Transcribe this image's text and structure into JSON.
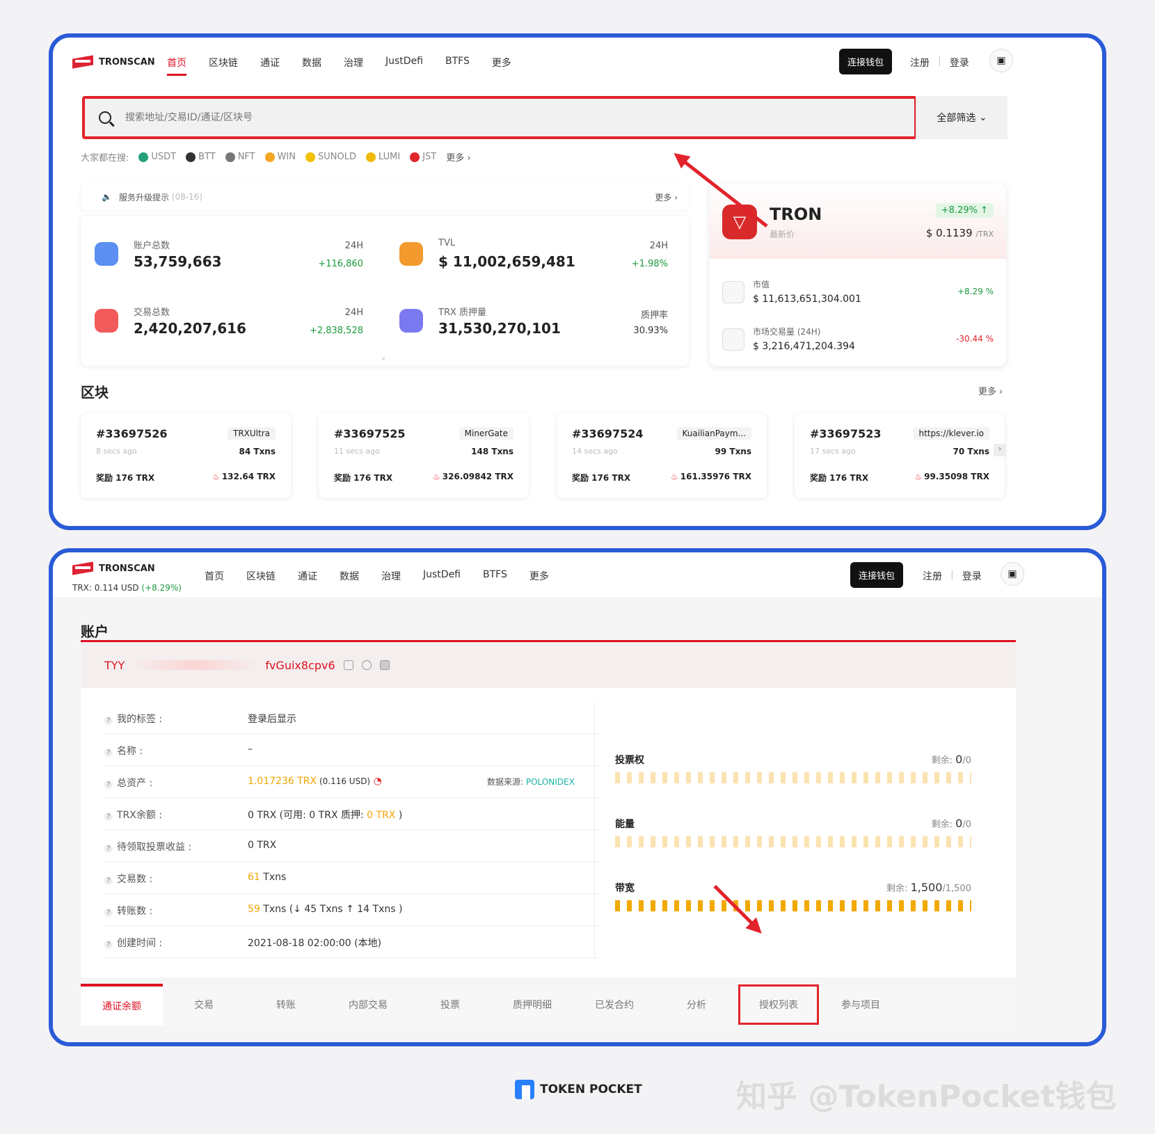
{
  "top": {
    "logo": "TRONSCAN",
    "menu": [
      "首页",
      "区块链",
      "通证",
      "数据",
      "治理",
      "JustDefi",
      "BTFS",
      "更多"
    ],
    "connect": "连接钱包",
    "register": "注册",
    "login": "登录",
    "search_placeholder": "搜索地址/交易ID/通证/区块号",
    "filter": "全部筛选",
    "hot_label": "大家都在搜:",
    "hot": [
      "USDT",
      "BTT",
      "NFT",
      "WIN",
      "SUNOLD",
      "LUMI",
      "JST"
    ],
    "hot_colors": [
      "#26a17b",
      "#333",
      "#555",
      "#f5a623",
      "#f2c100",
      "#f0b90b",
      "#e0262b"
    ],
    "hot_more": "更多",
    "notice": "服务升级提示",
    "notice_date": "(08-16)",
    "notice_more": "更多",
    "stats": [
      {
        "label": "账户总数",
        "value": "53,759,663",
        "h": "24H",
        "change": "+116,860",
        "color": "#5b8ff2"
      },
      {
        "label": "TVL",
        "value": "$ 11,002,659,481",
        "h": "24H",
        "change": "+1.98%",
        "color": "#f39a2e"
      },
      {
        "label": "交易总数",
        "value": "2,420,207,616",
        "h": "24H",
        "change": "+2,838,528",
        "color": "#f05a5a"
      },
      {
        "label": "TRX 质押量",
        "value": "31,530,270,101",
        "h": "质押率",
        "change": "30.93%",
        "color": "#7b79f0"
      }
    ],
    "tron": {
      "name": "TRON",
      "sub": "最新价",
      "change": "+8.29%",
      "price": "$ 0.1139",
      "unit": "/TRX",
      "rows": [
        {
          "label": "市值",
          "value": "$ 11,613,651,304.001",
          "change": "+8.29 %",
          "color": "#1a9a3c"
        },
        {
          "label": "市场交易量 (24H)",
          "value": "$ 3,216,471,204.394",
          "change": "-30.44 %",
          "color": "#e2232b"
        }
      ]
    },
    "blocks_title": "区块",
    "blocks_more": "更多",
    "blocks": [
      {
        "num": "#33697526",
        "miner": "TRXUltra",
        "ago": "8 secs ago",
        "txns": "84 Txns",
        "reward": "奖励 176 TRX",
        "burn": "132.64 TRX"
      },
      {
        "num": "#33697525",
        "miner": "MinerGate",
        "ago": "11 secs ago",
        "txns": "148 Txns",
        "reward": "奖励 176 TRX",
        "burn": "326.09842 TRX"
      },
      {
        "num": "#33697524",
        "miner": "KuailianPaym...",
        "ago": "14 secs ago",
        "txns": "99 Txns",
        "reward": "奖励 176 TRX",
        "burn": "161.35976 TRX"
      },
      {
        "num": "#33697523",
        "miner": "https://klever.io",
        "ago": "17 secs ago",
        "txns": "70 Txns",
        "reward": "奖励 176 TRX",
        "burn": "99.35098 TRX"
      }
    ]
  },
  "bottom": {
    "logo": "TRONSCAN",
    "price_label": "TRX: 0.114 USD",
    "price_change": "(+8.29%)",
    "menu": [
      "首页",
      "区块链",
      "通证",
      "数据",
      "治理",
      "JustDefi",
      "BTFS",
      "更多"
    ],
    "connect": "连接钱包",
    "register": "注册",
    "login": "登录",
    "title": "账户",
    "addr_prefix": "TYY",
    "addr_suffix": "fvGuix8cpv6",
    "rows": [
      {
        "k": "我的标签 :",
        "v": "登录后显示"
      },
      {
        "k": "名称 :",
        "v": "–"
      },
      {
        "k": "总资产 :",
        "v1": "1.017236 TRX",
        "v2": " (0.116 USD)",
        "src_label": "数据来源:",
        "src": "POLONIDEX"
      },
      {
        "k": "TRX余额 :",
        "v1": "0 TRX (可用: 0 TRX  质押: ",
        "v2": "0 TRX",
        " v3": " )"
      },
      {
        "k": "待领取投票收益 :",
        "v": "0 TRX"
      },
      {
        "k": "交易数 :",
        "v1": "61",
        "v2": " Txns"
      },
      {
        "k": "转账数 :",
        "v1": "59",
        "v2": " Txns (↓ 45 Txns ↑ 14 Txns )"
      },
      {
        "k": "创建时间 :",
        "v": "2021-08-18 02:00:00 (本地)"
      }
    ],
    "resources": [
      {
        "name": "投票权",
        "remain_label": "剩余:",
        "remain": "0",
        "total": "/0",
        "level": 0
      },
      {
        "name": "能量",
        "remain_label": "剩余:",
        "remain": "0",
        "total": "/0",
        "level": 0
      },
      {
        "name": "带宽",
        "remain_label": "剩余:",
        "remain": "1,500",
        "total": "/1,500",
        "level": 1
      }
    ],
    "tabs": [
      "通证余额",
      "交易",
      "转账",
      "内部交易",
      "投票",
      "质押明细",
      "已发合约",
      "分析",
      "授权列表",
      "参与项目"
    ]
  },
  "footer": {
    "brand": "TOKEN POCKET",
    "watermark": "知乎 @TokenPocket钱包"
  }
}
